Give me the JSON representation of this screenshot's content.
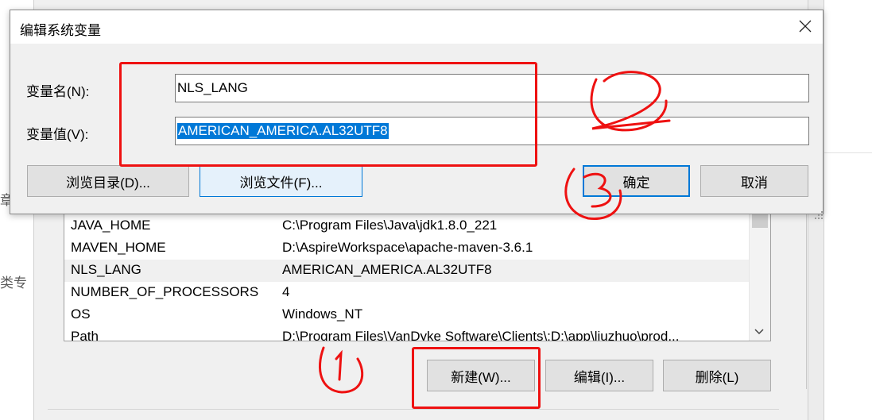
{
  "background": {
    "left_fragments": [
      "章",
      "类专"
    ]
  },
  "edit_dialog": {
    "title": "编辑系统变量",
    "name_label": "变量名(N):",
    "value_label": "变量值(V):",
    "name_value": "NLS_LANG",
    "value_value": "AMERICAN_AMERICA.AL32UTF8",
    "browse_dir_label": "浏览目录(D)...",
    "browse_file_label": "浏览文件(F)...",
    "ok_label": "确定",
    "cancel_label": "取消"
  },
  "system_variables": {
    "rows": [
      {
        "name": "JAVA_HOME",
        "value": "C:\\Program Files\\Java\\jdk1.8.0_221"
      },
      {
        "name": "MAVEN_HOME",
        "value": "D:\\AspireWorkspace\\apache-maven-3.6.1"
      },
      {
        "name": "NLS_LANG",
        "value": "AMERICAN_AMERICA.AL32UTF8"
      },
      {
        "name": "NUMBER_OF_PROCESSORS",
        "value": "4"
      },
      {
        "name": "OS",
        "value": "Windows_NT"
      },
      {
        "name": "Path",
        "value": "D:\\Program Files\\VanDyke Software\\Clients\\;D:\\app\\liuzhuo\\prod..."
      }
    ],
    "selected_row": "NLS_LANG",
    "new_label": "新建(W)...",
    "edit_label": "编辑(I)...",
    "delete_label": "删除(L)"
  },
  "colors": {
    "selection": "#0078d7",
    "annotation_red": "#ee1111",
    "dialog_bg": "#f0f0f0"
  }
}
